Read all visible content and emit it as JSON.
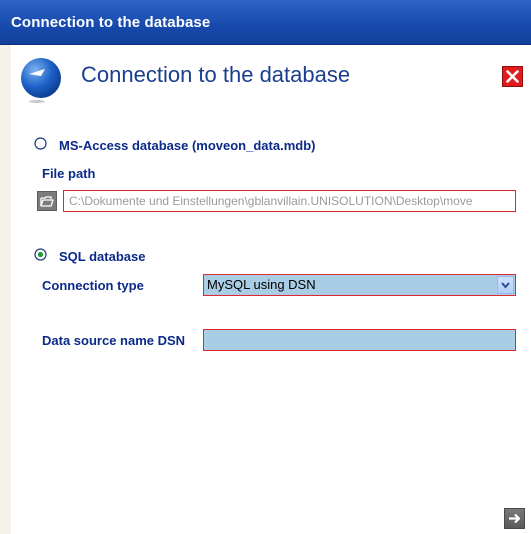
{
  "window": {
    "title": "Connection to the database"
  },
  "dialog": {
    "heading": "Connection to the database",
    "logo_icon": "db-logo-icon",
    "close_icon": "close-icon"
  },
  "access": {
    "option_label": "MS-Access database (moveon_data.mdb)",
    "selected": false,
    "file_path_label": "File path",
    "file_path_value": "C:\\Dokumente und Einstellungen\\gblanvillain.UNISOLUTION\\Desktop\\move",
    "browse_icon": "folder-open-icon"
  },
  "sql": {
    "option_label": "SQL database",
    "selected": true,
    "connection_type_label": "Connection type",
    "connection_type_value": "MySQL using DSN",
    "dsn_label": "Data source name DSN",
    "dsn_value": ""
  },
  "footer": {
    "next_icon": "arrow-right-icon"
  },
  "colors": {
    "titlebar": "#1749ad",
    "label_blue": "#0b2a8a",
    "field_fill": "#aacde6",
    "field_border_error": "#e0282e",
    "close_red": "#e11b1b"
  }
}
